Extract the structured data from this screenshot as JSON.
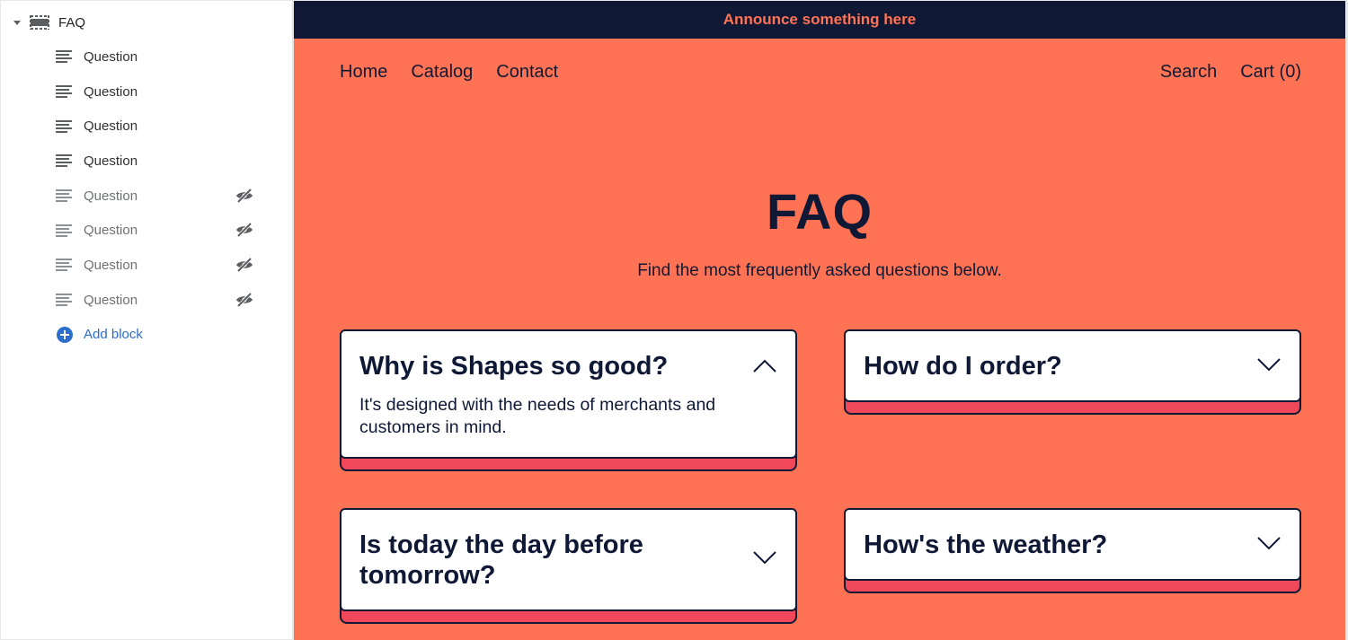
{
  "sidebar": {
    "section": {
      "label": "FAQ",
      "icon": "section-icon"
    },
    "blocks": [
      {
        "label": "Question",
        "hidden": false
      },
      {
        "label": "Question",
        "hidden": false
      },
      {
        "label": "Question",
        "hidden": false
      },
      {
        "label": "Question",
        "hidden": false
      },
      {
        "label": "Question",
        "hidden": true
      },
      {
        "label": "Question",
        "hidden": true
      },
      {
        "label": "Question",
        "hidden": true
      },
      {
        "label": "Question",
        "hidden": true
      }
    ],
    "add_block_label": "Add block"
  },
  "preview": {
    "announcement": "Announce something here",
    "nav_left": [
      "Home",
      "Catalog",
      "Contact"
    ],
    "nav_right": [
      "Search",
      "Cart (0)"
    ],
    "title": "FAQ",
    "subtitle": "Find the most frequently asked questions below.",
    "faqs": [
      {
        "question": "Why is Shapes so good?",
        "answer": "It's designed with the needs of merchants and customers in mind.",
        "expanded": true
      },
      {
        "question": "How do I order?",
        "expanded": false
      },
      {
        "question": "Is today the day before tomorrow?",
        "expanded": false
      },
      {
        "question": "How's the weather?",
        "expanded": false
      }
    ]
  },
  "colors": {
    "background": "#ff7354",
    "announcement_bg": "#0f1935",
    "text_dark": "#0f1935",
    "card_shadow": "#f0475b",
    "link_blue": "#2c6ecb"
  }
}
